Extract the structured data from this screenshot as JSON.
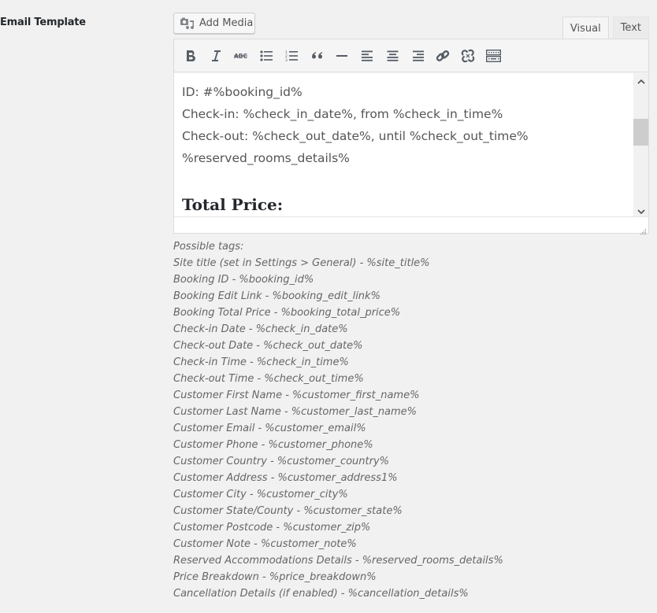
{
  "field": {
    "label": "Email Template"
  },
  "editor": {
    "add_media_label": "Add Media",
    "tabs": [
      {
        "label": "Visual",
        "active": true
      },
      {
        "label": "Text",
        "active": false
      }
    ],
    "toolbar": [
      {
        "name": "bold",
        "icon": "bold-icon"
      },
      {
        "name": "italic",
        "icon": "italic-icon"
      },
      {
        "name": "strikethrough",
        "icon": "strikethrough-icon"
      },
      {
        "name": "bulleted-list",
        "icon": "bulleted-list-icon"
      },
      {
        "name": "numbered-list",
        "icon": "numbered-list-icon"
      },
      {
        "name": "blockquote",
        "icon": "blockquote-icon"
      },
      {
        "name": "horizontal-line",
        "icon": "horizontal-line-icon"
      },
      {
        "name": "align-left",
        "icon": "align-left-icon"
      },
      {
        "name": "align-center",
        "icon": "align-center-icon"
      },
      {
        "name": "align-right",
        "icon": "align-right-icon"
      },
      {
        "name": "insert-link",
        "icon": "link-icon"
      },
      {
        "name": "remove-link",
        "icon": "unlink-icon"
      },
      {
        "name": "toolbar-toggle",
        "icon": "keyboard-icon"
      }
    ],
    "content": {
      "lines": [
        "ID: #%booking_id%",
        "Check-in: %check_in_date%, from %check_in_time%",
        "Check-out: %check_out_date%, until %check_out_time%",
        "%reserved_rooms_details%"
      ],
      "heading": "Total Price:"
    }
  },
  "tags": {
    "title": "Possible tags:",
    "items": [
      "Site title (set in Settings > General) - %site_title%",
      "Booking ID - %booking_id%",
      "Booking Edit Link - %booking_edit_link%",
      "Booking Total Price - %booking_total_price%",
      "Check-in Date - %check_in_date%",
      "Check-out Date - %check_out_date%",
      "Check-in Time - %check_in_time%",
      "Check-out Time - %check_out_time%",
      "Customer First Name - %customer_first_name%",
      "Customer Last Name - %customer_last_name%",
      "Customer Email - %customer_email%",
      "Customer Phone - %customer_phone%",
      "Customer Country - %customer_country%",
      "Customer Address - %customer_address1%",
      "Customer City - %customer_city%",
      "Customer State/County - %customer_state%",
      "Customer Postcode - %customer_zip%",
      "Customer Note - %customer_note%",
      "Reserved Accommodations Details - %reserved_rooms_details%",
      "Price Breakdown - %price_breakdown%",
      "Cancellation Details (if enabled) - %cancellation_details%"
    ]
  }
}
